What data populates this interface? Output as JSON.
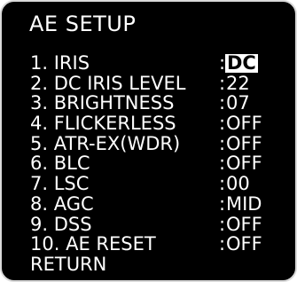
{
  "screen": {
    "title": "AE SETUP"
  },
  "menu": {
    "items": [
      {
        "label": "1. IRIS",
        "value": "DC",
        "selected": true
      },
      {
        "label": "2. DC IRIS LEVEL",
        "value": "22",
        "selected": false
      },
      {
        "label": "3. BRIGHTNESS",
        "value": "07",
        "selected": false
      },
      {
        "label": "4. FLICKERLESS",
        "value": "OFF",
        "selected": false
      },
      {
        "label": "5. ATR-EX(WDR)",
        "value": "OFF",
        "selected": false
      },
      {
        "label": "6. BLC",
        "value": "OFF",
        "selected": false
      },
      {
        "label": "7. LSC",
        "value": "00",
        "selected": false
      },
      {
        "label": "8. AGC",
        "value": "MID",
        "selected": false
      },
      {
        "label": "9. DSS",
        "value": "OFF",
        "selected": false
      },
      {
        "label": "10. AE RESET",
        "value": "OFF",
        "selected": false
      }
    ],
    "separator": ":",
    "return_label": "RETURN"
  },
  "colors": {
    "background": "#000000",
    "text": "#ffffff",
    "highlight_bg": "#ffffff",
    "highlight_text": "#000000",
    "frame": "#d9d9d9"
  }
}
